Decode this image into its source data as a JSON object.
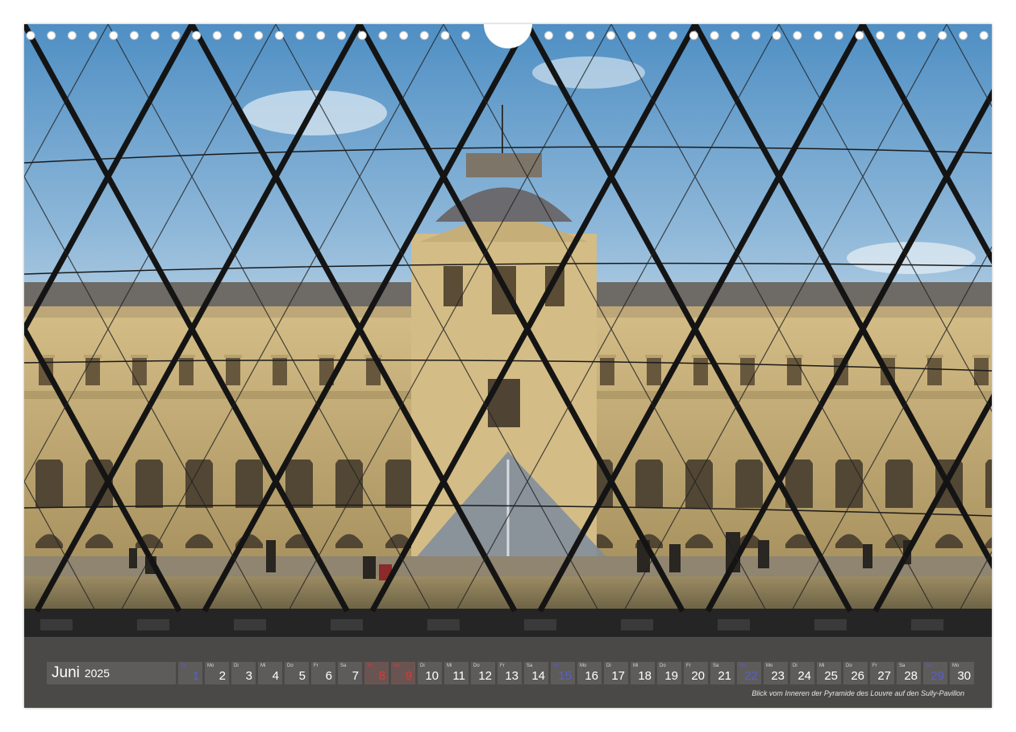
{
  "calendar": {
    "month": "Juni",
    "year": "2025",
    "days": [
      {
        "wd": "So",
        "num": "1",
        "type": "sun"
      },
      {
        "wd": "Mo",
        "num": "2",
        "type": "normal"
      },
      {
        "wd": "Di",
        "num": "3",
        "type": "normal"
      },
      {
        "wd": "Mi",
        "num": "4",
        "type": "normal"
      },
      {
        "wd": "Do",
        "num": "5",
        "type": "normal"
      },
      {
        "wd": "Fr",
        "num": "6",
        "type": "normal"
      },
      {
        "wd": "Sa",
        "num": "7",
        "type": "normal"
      },
      {
        "wd": "So",
        "num": "8",
        "type": "holiday"
      },
      {
        "wd": "Mo",
        "num": "9",
        "type": "holiday"
      },
      {
        "wd": "Di",
        "num": "10",
        "type": "normal"
      },
      {
        "wd": "Mi",
        "num": "11",
        "type": "normal"
      },
      {
        "wd": "Do",
        "num": "12",
        "type": "normal"
      },
      {
        "wd": "Fr",
        "num": "13",
        "type": "normal"
      },
      {
        "wd": "Sa",
        "num": "14",
        "type": "normal"
      },
      {
        "wd": "So",
        "num": "15",
        "type": "sun"
      },
      {
        "wd": "Mo",
        "num": "16",
        "type": "normal"
      },
      {
        "wd": "Di",
        "num": "17",
        "type": "normal"
      },
      {
        "wd": "Mi",
        "num": "18",
        "type": "normal"
      },
      {
        "wd": "Do",
        "num": "19",
        "type": "normal"
      },
      {
        "wd": "Fr",
        "num": "20",
        "type": "normal"
      },
      {
        "wd": "Sa",
        "num": "21",
        "type": "normal"
      },
      {
        "wd": "So",
        "num": "22",
        "type": "sun"
      },
      {
        "wd": "Mo",
        "num": "23",
        "type": "normal"
      },
      {
        "wd": "Di",
        "num": "24",
        "type": "normal"
      },
      {
        "wd": "Mi",
        "num": "25",
        "type": "normal"
      },
      {
        "wd": "Do",
        "num": "26",
        "type": "normal"
      },
      {
        "wd": "Fr",
        "num": "27",
        "type": "normal"
      },
      {
        "wd": "Sa",
        "num": "28",
        "type": "normal"
      },
      {
        "wd": "So",
        "num": "29",
        "type": "sun"
      },
      {
        "wd": "Mo",
        "num": "30",
        "type": "normal"
      }
    ]
  },
  "photo": {
    "caption": "Blick vom Inneren der Pyramide des Louvre auf den Sully-Pavillon"
  },
  "colors": {
    "sky_top": "#4f8fc4",
    "sky_bottom": "#b9d3e6",
    "stone": "#c9b27e",
    "lattice": "#141414",
    "sunday": "#5a5fc8",
    "holiday": "#d63a3a"
  }
}
